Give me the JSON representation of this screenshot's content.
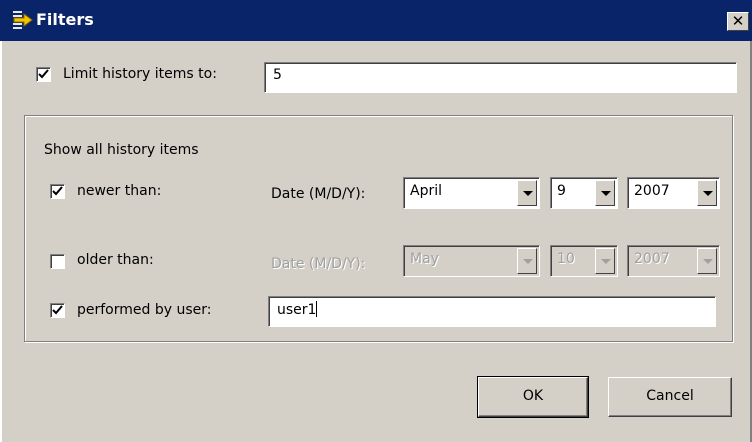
{
  "window": {
    "title": "Filters"
  },
  "limit": {
    "label": "Limit history items to:",
    "checked": true,
    "value": "5"
  },
  "group": {
    "title": "Show all history items"
  },
  "newer": {
    "label": "newer than:",
    "checked": true,
    "date_label": "Date (M/D/Y):",
    "month": "April",
    "day": "9",
    "year": "2007"
  },
  "older": {
    "label": "older than:",
    "checked": false,
    "date_label": "Date (M/D/Y):",
    "month": "May",
    "day": "10",
    "year": "2007"
  },
  "user": {
    "label": "performed by user:",
    "checked": true,
    "value": "user1"
  },
  "buttons": {
    "ok": "OK",
    "cancel": "Cancel"
  },
  "icons": {
    "title": "filter-arrow-icon",
    "close": "close-icon"
  },
  "colors": {
    "titlebar": "#0a246a",
    "face": "#d4d0c8"
  }
}
